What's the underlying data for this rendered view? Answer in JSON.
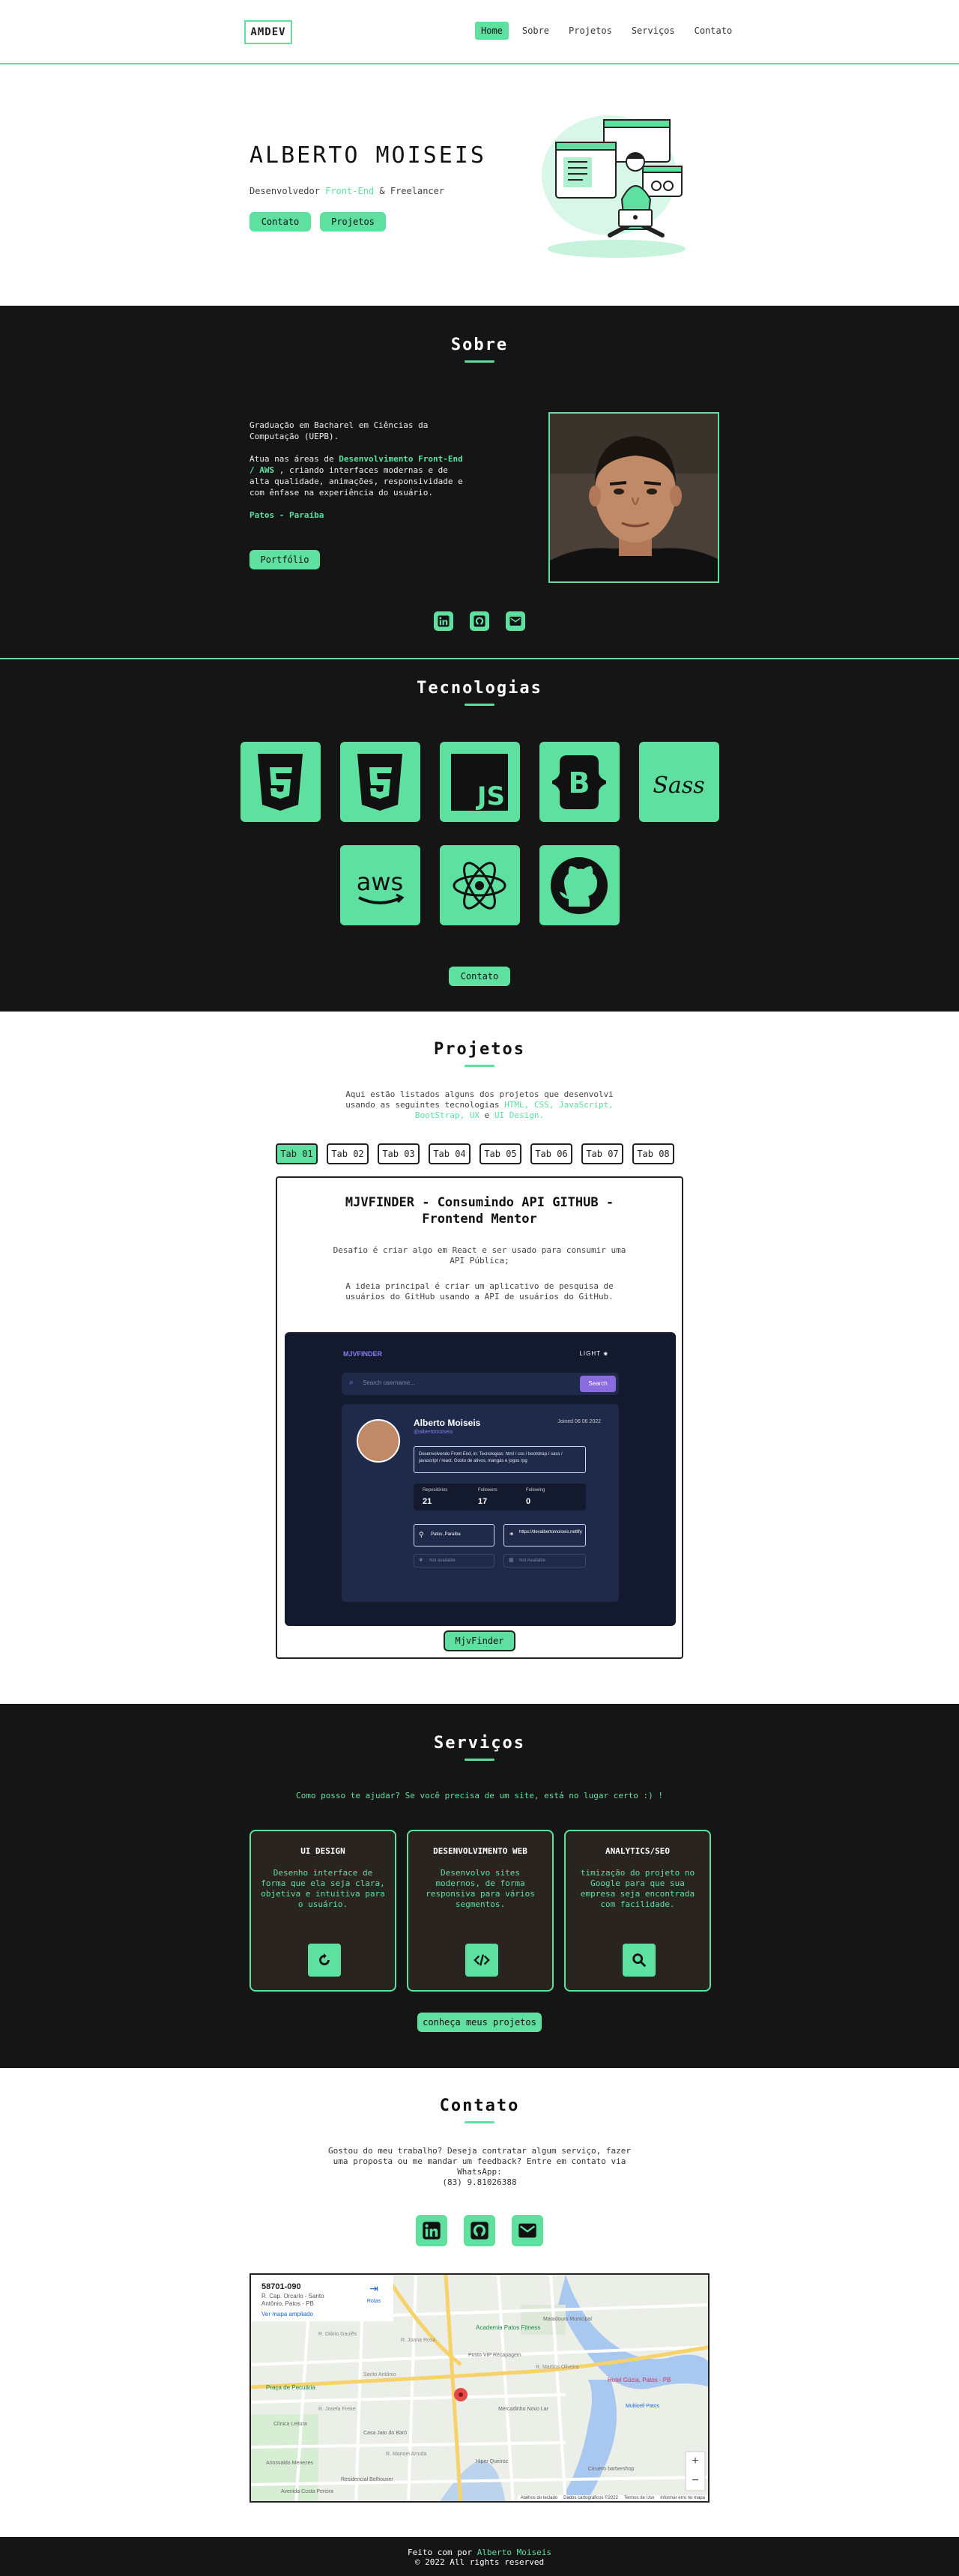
{
  "nav": {
    "logo": "AMDEV",
    "links": [
      "Home",
      "Sobre",
      "Projetos",
      "Serviços",
      "Contato"
    ]
  },
  "hero": {
    "name": "ALBERTO MOISEIS",
    "subtitle_pre": "Desenvolvedor ",
    "subtitle_hl": "Front-End",
    "subtitle_post": " & Freelancer",
    "btn_contato": "Contato",
    "btn_projetos": "Projetos"
  },
  "sobre": {
    "title": "Sobre",
    "p1": "Graduação em Bacharel em Ciências da Computação (UEPB).",
    "p2_pre": "Atua nas áreas de ",
    "p2_hl": "Desenvolvimento Front-End / AWS",
    "p2_post": " , criando interfaces modernas e de alta qualidade, animações, responsividade e com ênfase na experiência do usuário.",
    "location": "Patos - Paraíba",
    "btn": "Portfólio"
  },
  "tecnologias": {
    "title": "Tecnologias",
    "icons": [
      "html5-icon",
      "css3-icon",
      "javascript-icon",
      "bootstrap-icon",
      "sass-icon",
      "aws-icon",
      "react-icon",
      "github-icon"
    ],
    "js_text": "JS",
    "bs_text": "B",
    "sass_text": "Sass",
    "aws_text": "aws",
    "btn": "Contato"
  },
  "projetos": {
    "title": "Projetos",
    "intro_pre": "Aqui estão listados alguns dos projetos que desenvolvi usando as seguintes tecnologias ",
    "intro_hl": "HTML, CSS, JavaScript, BootStrap, UX",
    "intro_mid": " e ",
    "intro_hl2": "UI Design.",
    "tabs": [
      "Tab 01",
      "Tab 02",
      "Tab 03",
      "Tab 04",
      "Tab 05",
      "Tab 06",
      "Tab 07",
      "Tab 08"
    ],
    "card": {
      "title": "MJVFINDER - Consumindo API GITHUB - Frontend Mentor",
      "desc1": "Desafio é criar algo em React e ser usado para consumir uma API Pública;",
      "desc2": "A ideia principal é criar um aplicativo de pesquisa de usuários do GitHub usando a API de usuários do GitHub.",
      "btn": "MjvFinder",
      "shot": {
        "brand": "MJVFINDER",
        "mode": "LIGHT",
        "search_placeholder": "Search username...",
        "search_btn": "Search",
        "user_name": "Alberto Moiseis",
        "user_handle": "@albertomoiseis",
        "joined": "Joined 06 06 2022",
        "bio": "Desenvolvendo Front End, in: Tecnologias: html / css / bootstrap / sass / javascript / react. Gosto de ativos, mangás e jogos rpg",
        "stats": [
          {
            "label": "Repositórios",
            "value": "21"
          },
          {
            "label": "Followers",
            "value": "17"
          },
          {
            "label": "Following",
            "value": "0"
          }
        ],
        "location": "Patos, Paraíba",
        "link": "https://devalbertomoiseis.netlify.app/",
        "twitter": "Not available",
        "company": "Not Available"
      }
    }
  },
  "servicos": {
    "title": "Serviços",
    "tagline": "Como posso te ajudar? Se você precisa de um site, está no lugar certo :) !",
    "cards": [
      {
        "title": "UI DESIGN",
        "desc": "Desenho interface de forma que ela seja clara, objetiva e intuitiva para o usuário."
      },
      {
        "title": "DESENVOLVIMENTO WEB",
        "desc": "Desenvolvo sites modernos, de forma responsiva para vários segmentos."
      },
      {
        "title": "ANALYTICS/SEO",
        "desc": "timização do projeto no Google para que sua empresa seja encontrada com facilidade."
      }
    ],
    "btn": "conheça meus projetos"
  },
  "contato": {
    "title": "Contato",
    "msg": "Gostou do meu trabalho? Deseja contratar algum serviço, fazer uma proposta ou me mandar um feedback? Entre em contato via WhatsApp:",
    "phone": "(83) 9.81026388",
    "map": {
      "cep": "58701-090",
      "address": "R. Cap. Orcarlo - Santo Antônio, Patos - PB",
      "more": "Ver mapa ampliado",
      "route": "Rotas",
      "places": [
        "Academia Patos Fitness",
        "Hotel Gúcia, Patos - PB",
        "Praça de Pecuária",
        "Posto VIP Recapagem",
        "Mercadinho Novo Lar",
        "Multicell Patos",
        "Clínica Leitura",
        "Casa Jato do Baró",
        "Cicuero barbershop",
        "Hiper Queiroz",
        "Ariosvaldo Menezes",
        "Residencial Belhouver",
        "Avenida Costa Pereira",
        "Matadouro Municipal"
      ],
      "streets": [
        "R. Diário Gaulês",
        "R. Joana Rosa",
        "Santo Antônio",
        "R. Martins Oliveira",
        "R. Josefa Freire",
        "R. Manoel Arruda"
      ],
      "zoom_in": "+",
      "zoom_out": "−",
      "footer_items": [
        "Atalhos do teclado",
        "Dados cartográficos ©2022",
        "Termos de Uso",
        "Informar erro no mapa"
      ]
    }
  },
  "footer": {
    "made_pre": "Feito com por ",
    "made_hl": "Alberto Moiseis",
    "rights": "© 2022 All rights reserved"
  },
  "colors": {
    "accent": "#5ee0a0",
    "dark": "#151515",
    "card": "#2a2420"
  }
}
